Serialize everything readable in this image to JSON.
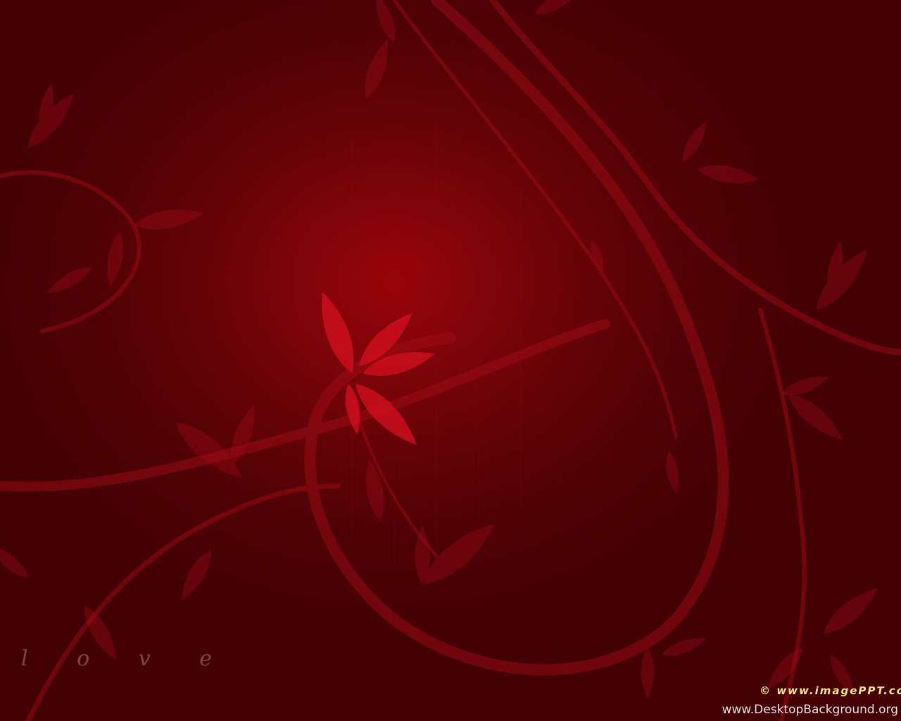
{
  "background": {
    "base_color": "#4a0104",
    "glow_color": "#9a040b",
    "motif_color": "#b4101a",
    "highlight_color": "#e01020"
  },
  "overlay": {
    "love_label": "l o v e",
    "copyright": "© www.imagePPT.co",
    "site": "www.DesktopBackground.org"
  }
}
